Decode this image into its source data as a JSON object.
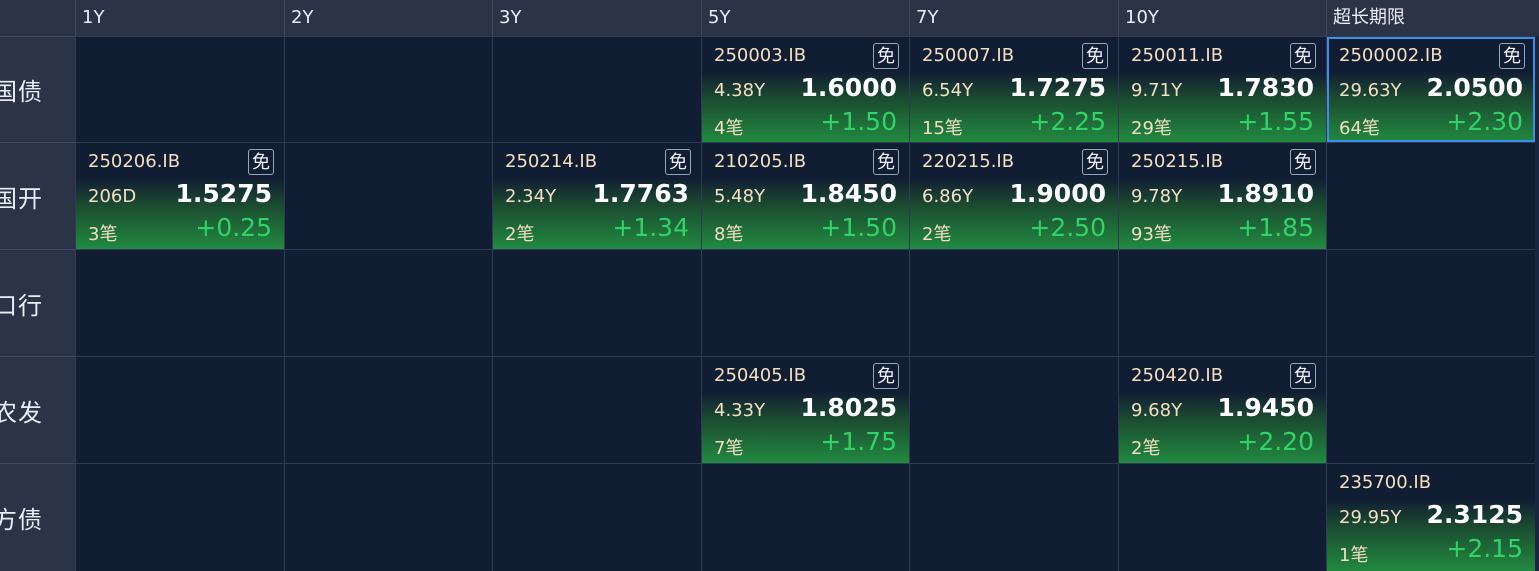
{
  "columns": [
    "1Y",
    "2Y",
    "3Y",
    "5Y",
    "7Y",
    "10Y",
    "超长期限"
  ],
  "rows": [
    "国债",
    "国开",
    "口行",
    "农发",
    "地方债"
  ],
  "colors": {
    "background": "#111d33",
    "header": "#2b3447",
    "positive_change": "#33d16a",
    "code_text": "#f3dfc2",
    "selected_border": "#3f8ee6"
  },
  "bonds": [
    {
      "row": 0,
      "col": 3,
      "code": "250003.IB",
      "tag": "免",
      "term": "4.38Y",
      "yield": "1.6000",
      "count": "4笔",
      "change": "+1.50"
    },
    {
      "row": 0,
      "col": 4,
      "code": "250007.IB",
      "tag": "免",
      "term": "6.54Y",
      "yield": "1.7275",
      "count": "15笔",
      "change": "+2.25"
    },
    {
      "row": 0,
      "col": 5,
      "code": "250011.IB",
      "tag": "免",
      "term": "9.71Y",
      "yield": "1.7830",
      "count": "29笔",
      "change": "+1.55"
    },
    {
      "row": 0,
      "col": 6,
      "code": "2500002.IB",
      "tag": "免",
      "term": "29.63Y",
      "yield": "2.0500",
      "count": "64笔",
      "change": "+2.30",
      "selected": true
    },
    {
      "row": 1,
      "col": 0,
      "code": "250206.IB",
      "tag": "免",
      "term": "206D",
      "yield": "1.5275",
      "count": "3笔",
      "change": "+0.25"
    },
    {
      "row": 1,
      "col": 2,
      "code": "250214.IB",
      "tag": "免",
      "term": "2.34Y",
      "yield": "1.7763",
      "count": "2笔",
      "change": "+1.34"
    },
    {
      "row": 1,
      "col": 3,
      "code": "210205.IB",
      "tag": "免",
      "term": "5.48Y",
      "yield": "1.8450",
      "count": "8笔",
      "change": "+1.50"
    },
    {
      "row": 1,
      "col": 4,
      "code": "220215.IB",
      "tag": "免",
      "term": "6.86Y",
      "yield": "1.9000",
      "count": "2笔",
      "change": "+2.50"
    },
    {
      "row": 1,
      "col": 5,
      "code": "250215.IB",
      "tag": "免",
      "term": "9.78Y",
      "yield": "1.8910",
      "count": "93笔",
      "change": "+1.85"
    },
    {
      "row": 3,
      "col": 3,
      "code": "250405.IB",
      "tag": "免",
      "term": "4.33Y",
      "yield": "1.8025",
      "count": "7笔",
      "change": "+1.75"
    },
    {
      "row": 3,
      "col": 5,
      "code": "250420.IB",
      "tag": "免",
      "term": "9.68Y",
      "yield": "1.9450",
      "count": "2笔",
      "change": "+2.20"
    },
    {
      "row": 4,
      "col": 6,
      "code": "235700.IB",
      "tag": "",
      "term": "29.95Y",
      "yield": "2.3125",
      "count": "1笔",
      "change": "+2.15"
    }
  ]
}
